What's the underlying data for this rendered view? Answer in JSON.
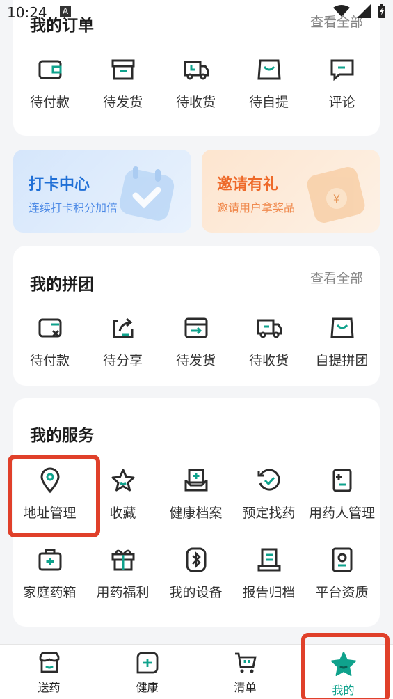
{
  "status_bar": {
    "time": "10:24",
    "notif_letter": "A"
  },
  "orders": {
    "title": "我的订单",
    "more": "查看全部",
    "items": [
      {
        "label": "待付款",
        "icon": "wallet-icon"
      },
      {
        "label": "待发货",
        "icon": "box-icon"
      },
      {
        "label": "待收货",
        "icon": "truck-icon"
      },
      {
        "label": "待自提",
        "icon": "bag-icon"
      },
      {
        "label": "评论",
        "icon": "comment-icon"
      }
    ]
  },
  "promos": [
    {
      "title": "打卡中心",
      "subtitle": "连续打卡积分加倍",
      "color": "#1f6fd6"
    },
    {
      "title": "邀请有礼",
      "subtitle": "邀请用户拿奖品",
      "color": "#ee6a2a"
    }
  ],
  "group_buy": {
    "title": "我的拼团",
    "more": "查看全部",
    "items": [
      {
        "label": "待付款",
        "icon": "wallet-x-icon"
      },
      {
        "label": "待分享",
        "icon": "share-icon"
      },
      {
        "label": "待发货",
        "icon": "box-arrow-icon"
      },
      {
        "label": "待收货",
        "icon": "truck-icon"
      },
      {
        "label": "自提拼团",
        "icon": "bag-icon"
      }
    ]
  },
  "services": {
    "title": "我的服务",
    "items": [
      {
        "label": "地址管理",
        "icon": "location-pin-icon"
      },
      {
        "label": "收藏",
        "icon": "star-icon"
      },
      {
        "label": "健康档案",
        "icon": "health-record-icon"
      },
      {
        "label": "预定找药",
        "icon": "reorder-icon"
      },
      {
        "label": "用药人管理",
        "icon": "patient-icon"
      },
      {
        "label": "家庭药箱",
        "icon": "medicine-box-icon"
      },
      {
        "label": "用药福利",
        "icon": "gift-icon"
      },
      {
        "label": "我的设备",
        "icon": "bluetooth-icon"
      },
      {
        "label": "报告归档",
        "icon": "report-icon"
      },
      {
        "label": "平台资质",
        "icon": "certificate-icon"
      }
    ]
  },
  "tabbar": [
    {
      "label": "送药",
      "icon": "store-icon"
    },
    {
      "label": "健康",
      "icon": "health-plus-icon"
    },
    {
      "label": "清单",
      "icon": "cart-icon"
    },
    {
      "label": "我的",
      "icon": "star-icon",
      "active": true
    }
  ],
  "colors": {
    "accent": "#0fa28c",
    "icon_dark": "#2b2b2b",
    "highlight": "#e0402a"
  }
}
